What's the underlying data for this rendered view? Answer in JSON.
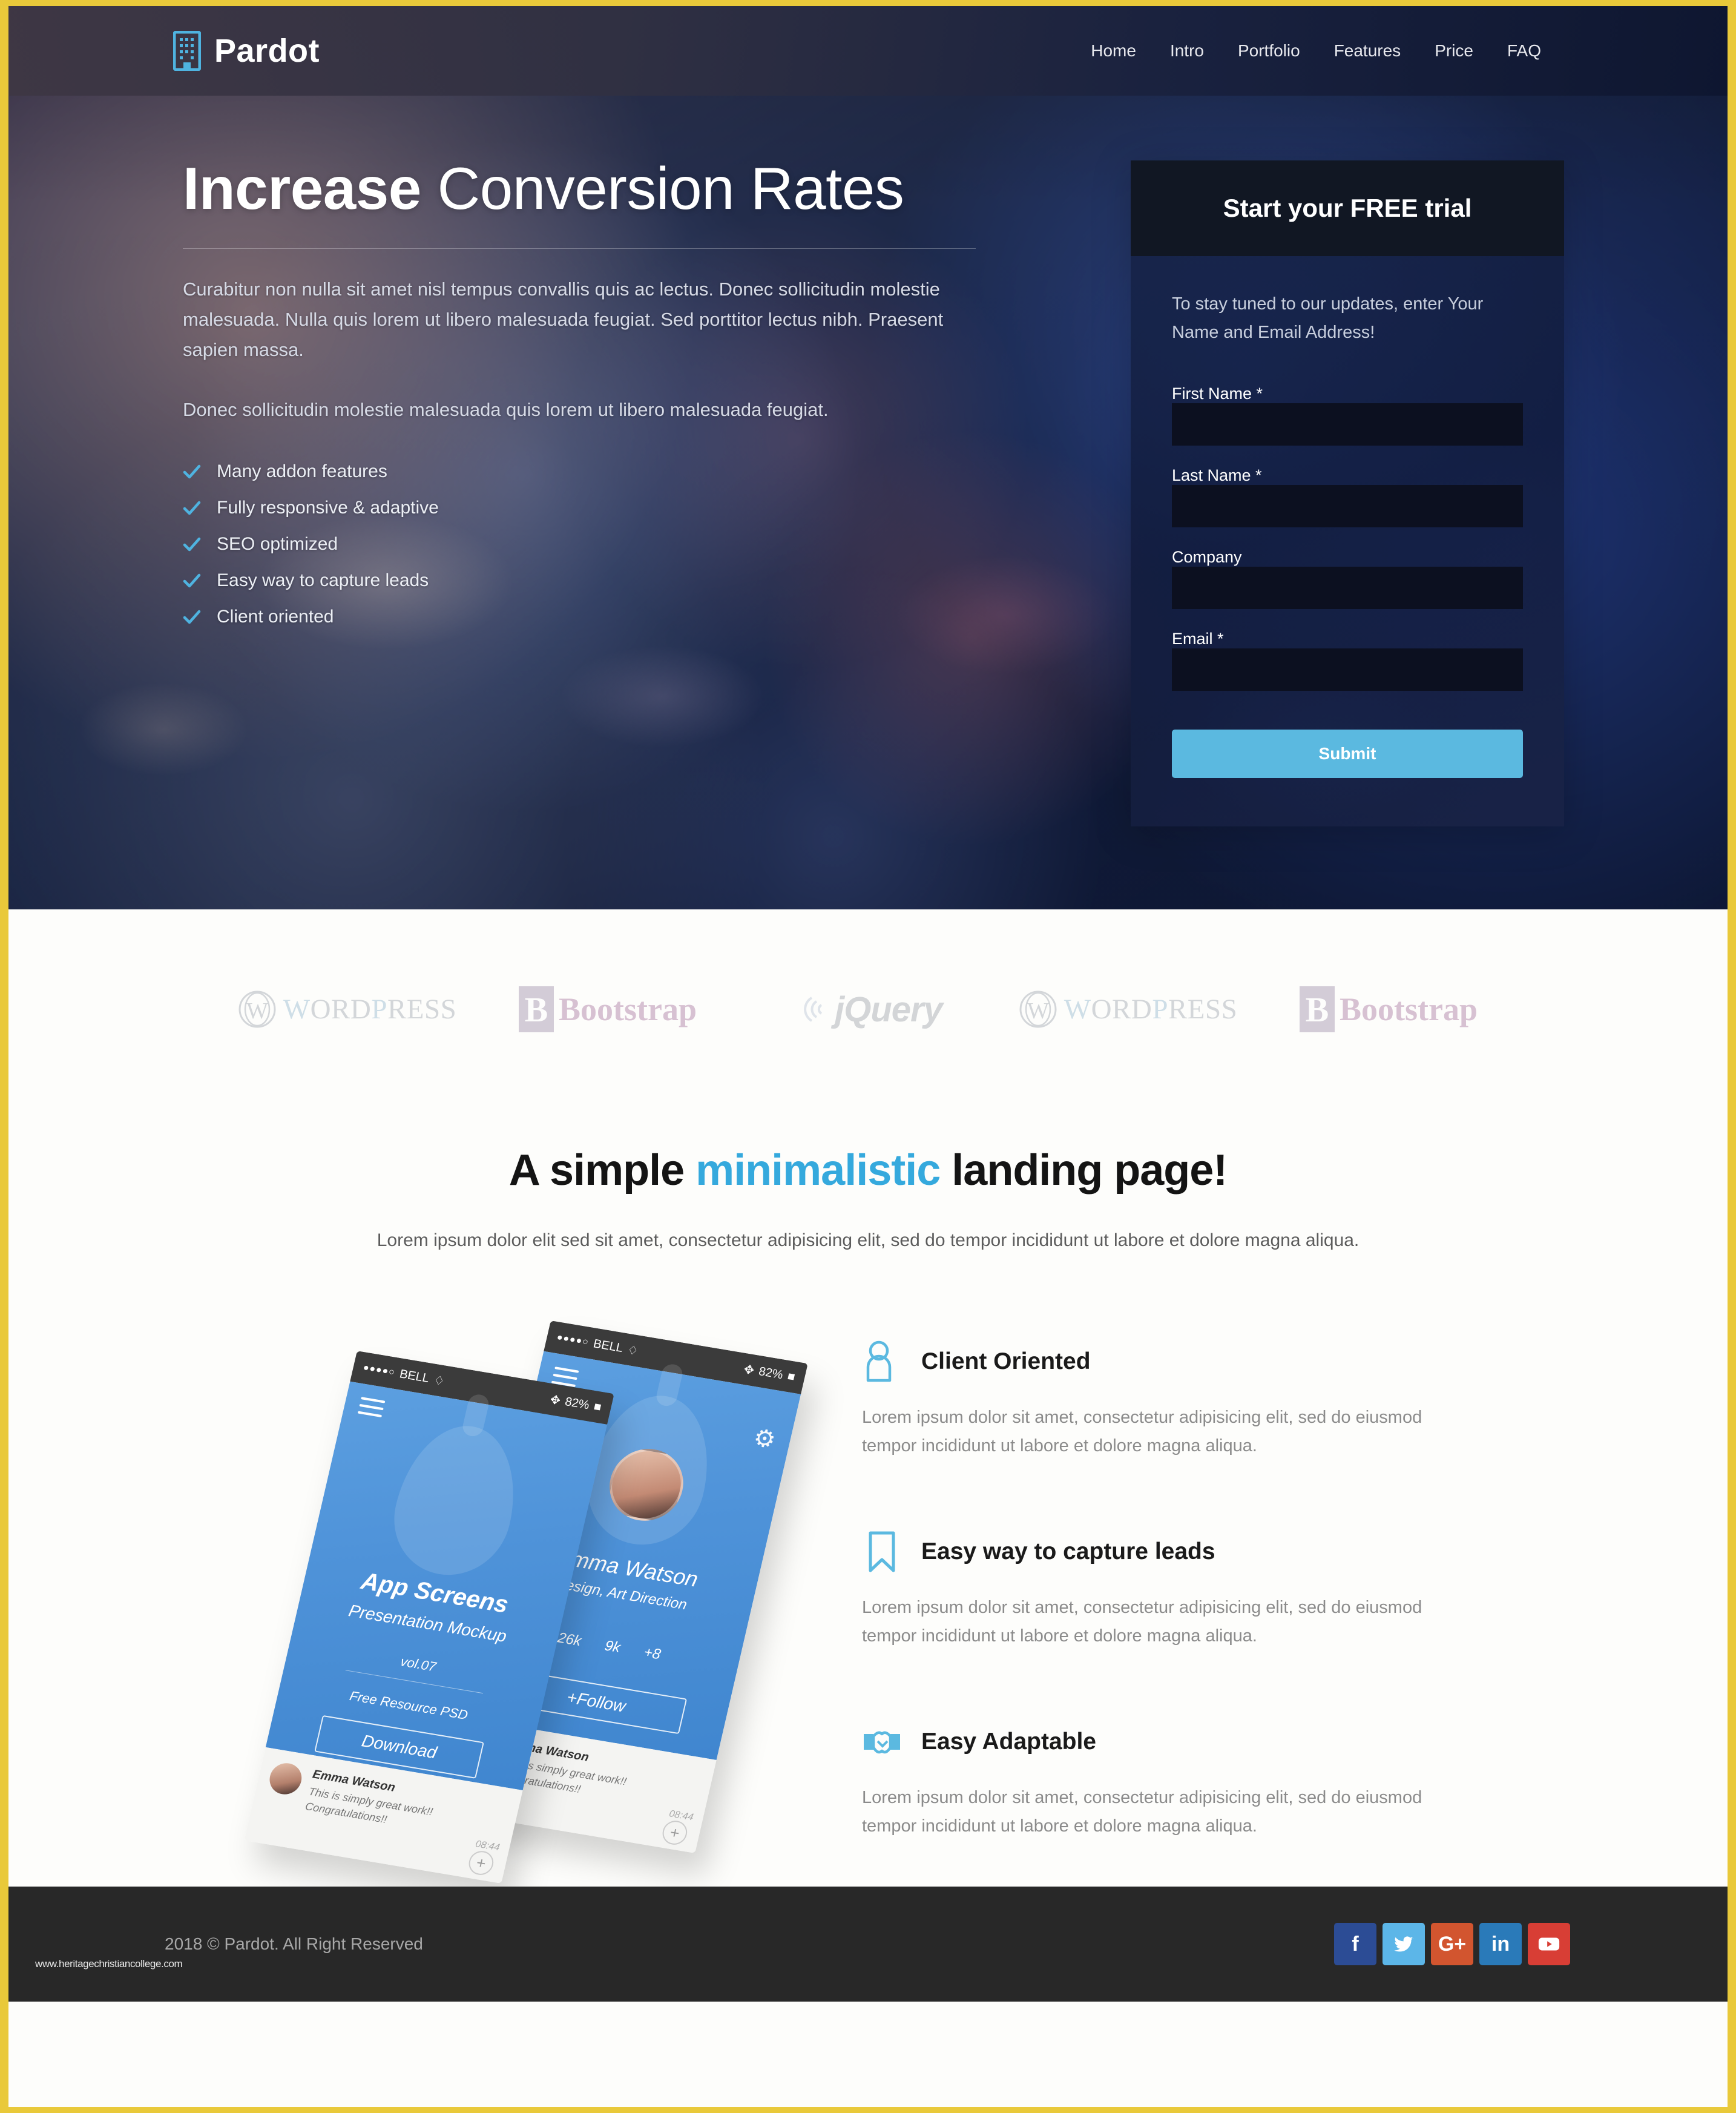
{
  "theme": {
    "page_border": "#e9c93a",
    "accent": "#5bb9e0",
    "accent_dark": "#35a9dd",
    "footer_bg": "#282828",
    "form_head_bg": "#111723"
  },
  "navbar": {
    "brand": "Pardot",
    "brand_icon": "building-icon",
    "links": [
      {
        "label": "Home"
      },
      {
        "label": "Intro"
      },
      {
        "label": "Portfolio"
      },
      {
        "label": "Features"
      },
      {
        "label": "Price"
      },
      {
        "label": "FAQ"
      }
    ]
  },
  "hero": {
    "title_bold": "Increase",
    "title_rest": " Conversion Rates",
    "paragraph1": "Curabitur non nulla sit amet nisl tempus convallis quis ac lectus. Donec sollicitudin molestie malesuada. Nulla quis lorem ut libero malesuada feugiat. Sed porttitor lectus nibh. Praesent sapien massa.",
    "paragraph2": "Donec sollicitudin molestie malesuada quis lorem ut libero malesuada feugiat.",
    "bullets": [
      {
        "label": "Many addon features"
      },
      {
        "label": "Fully responsive & adaptive"
      },
      {
        "label": "SEO optimized"
      },
      {
        "label": "Easy way to capture leads"
      },
      {
        "label": "Client oriented"
      }
    ]
  },
  "signup_form": {
    "heading": "Start your FREE trial",
    "intro": "To stay tuned to our updates, enter Your Name and Email Address!",
    "fields": [
      {
        "label": "First Name *",
        "value": "",
        "placeholder": ""
      },
      {
        "label": "Last Name *",
        "value": "",
        "placeholder": ""
      },
      {
        "label": "Company",
        "value": "",
        "placeholder": ""
      },
      {
        "label": "Email *",
        "value": "",
        "placeholder": ""
      }
    ],
    "submit_label": "Submit"
  },
  "logo_strip": {
    "items": [
      {
        "name": "wordpress-logo",
        "text_a": "W",
        "text_b": "ORD",
        "text_c": "P",
        "text_d": "RESS"
      },
      {
        "name": "bootstrap-logo",
        "mark": "B",
        "text": "Bootstrap"
      },
      {
        "name": "jquery-logo",
        "text": "jQuery"
      },
      {
        "name": "wordpress-logo",
        "text_a": "W",
        "text_b": "ORD",
        "text_c": "P",
        "text_d": "RESS"
      },
      {
        "name": "bootstrap-logo",
        "mark": "B",
        "text": "Bootstrap"
      }
    ]
  },
  "intro_section": {
    "title_a": "A simple ",
    "title_accent": "minimalistic",
    "title_b": " landing page!",
    "subtitle": "Lorem ipsum dolor elit sed sit amet, consectetur adipisicing elit, sed do tempor incididunt ut labore et dolore magna aliqua."
  },
  "features": [
    {
      "icon": "user-icon",
      "title": "Client Oriented",
      "text": "Lorem ipsum dolor sit amet, consectetur adipisicing elit, sed do eiusmod tempor incididunt ut labore et dolore magna aliqua."
    },
    {
      "icon": "bookmark-icon",
      "title": "Easy way to capture leads",
      "text": "Lorem ipsum dolor sit amet, consectetur adipisicing elit, sed do eiusmod tempor incididunt ut labore et dolore magna aliqua."
    },
    {
      "icon": "handshake-icon",
      "title": "Easy Adaptable",
      "text": "Lorem ipsum dolor sit amet, consectetur adipisicing elit, sed do eiusmod tempor incididunt ut labore et dolore magna aliqua."
    }
  ],
  "mockup": {
    "front": {
      "carrier": "BELL",
      "battery": "82%",
      "title": "App Screens",
      "subtitle": "Presentation Mockup",
      "volume": "vol.07",
      "resource": "Free Resource PSD",
      "button": "Download",
      "comment_name": "Emma Watson",
      "comment_text": "This is simply great work!! Congratulations!!",
      "comment_time": "08:44"
    },
    "back": {
      "carrier": "BELL",
      "battery": "82%",
      "name": "Emma Watson",
      "role": "Design, Art Direction",
      "stat1": "26k",
      "stat2": "9k",
      "extra": "+8",
      "button": "+Follow",
      "comment_name": "Emma Watson",
      "comment_text": "This is simply great work!! Congratulations!!",
      "comment_time": "08:44"
    }
  },
  "footer": {
    "copyright": "2018 © Pardot. All Right Reserved",
    "watermark": "www.heritagechristiancollege.com",
    "social": [
      {
        "name": "facebook-icon",
        "glyph": "f",
        "color": "#2c4c95"
      },
      {
        "name": "twitter-icon",
        "glyph": "",
        "color": "#5cb6e8"
      },
      {
        "name": "google-plus-icon",
        "glyph": "G+",
        "color": "#d2552f"
      },
      {
        "name": "linkedin-icon",
        "glyph": "in",
        "color": "#2a7ab9"
      },
      {
        "name": "youtube-icon",
        "glyph": "",
        "color": "#d83e35"
      }
    ]
  }
}
